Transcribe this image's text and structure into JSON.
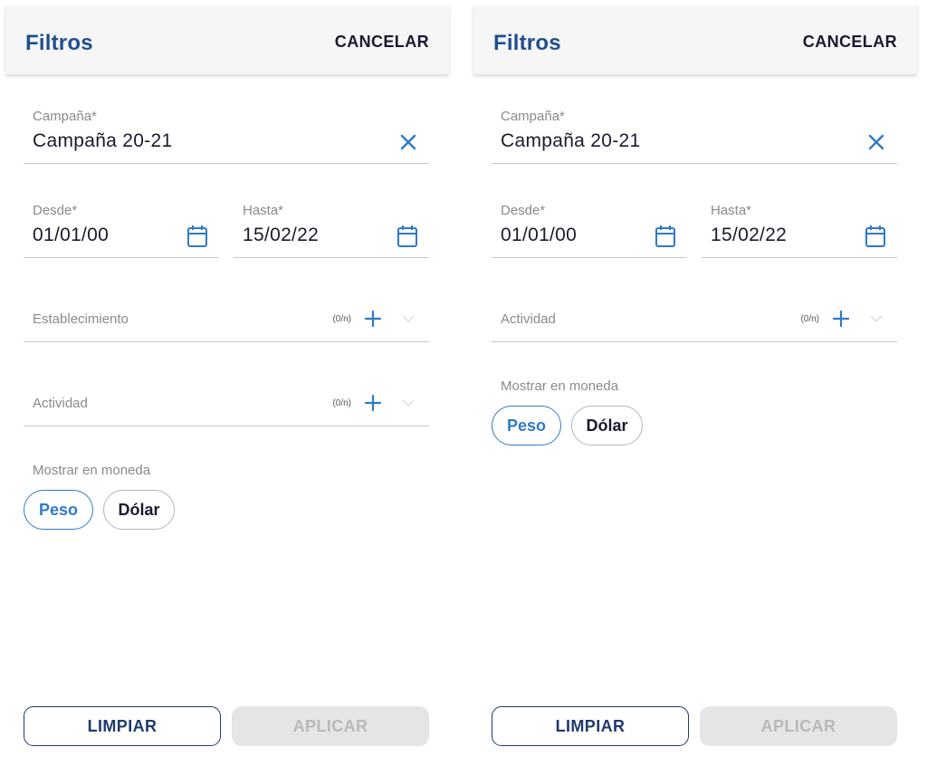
{
  "colors": {
    "accent": "#2f7ac7",
    "title": "#1f4f8f",
    "text": "#1a1a2e",
    "muted": "#8a8a8a",
    "disabled_bg": "#e5e5e5"
  },
  "left": {
    "header": {
      "title": "Filtros",
      "cancel": "CANCELAR"
    },
    "campaign": {
      "label": "Campaña*",
      "value": "Campaña 20-21",
      "clear_icon": "close-icon"
    },
    "from": {
      "label": "Desde*",
      "value": "01/01/00",
      "icon": "calendar-icon"
    },
    "to": {
      "label": "Hasta*",
      "value": "15/02/22",
      "icon": "calendar-icon"
    },
    "establishment": {
      "label": "Establecimiento",
      "count": "(0/n)"
    },
    "activity": {
      "label": "Actividad",
      "count": "(0/n)"
    },
    "currency": {
      "label": "Mostrar en moneda",
      "options": [
        "Peso",
        "Dólar"
      ],
      "selected": "Peso"
    },
    "buttons": {
      "clear": "LIMPIAR",
      "apply": "APLICAR"
    }
  },
  "right": {
    "header": {
      "title": "Filtros",
      "cancel": "CANCELAR"
    },
    "campaign": {
      "label": "Campaña*",
      "value": "Campaña 20-21",
      "clear_icon": "close-icon"
    },
    "from": {
      "label": "Desde*",
      "value": "01/01/00",
      "icon": "calendar-icon"
    },
    "to": {
      "label": "Hasta*",
      "value": "15/02/22",
      "icon": "calendar-icon"
    },
    "activity": {
      "label": "Actividad",
      "count": "(0/n)"
    },
    "currency": {
      "label": "Mostrar en moneda",
      "options": [
        "Peso",
        "Dólar"
      ],
      "selected": "Peso"
    },
    "buttons": {
      "clear": "LIMPIAR",
      "apply": "APLICAR"
    }
  }
}
